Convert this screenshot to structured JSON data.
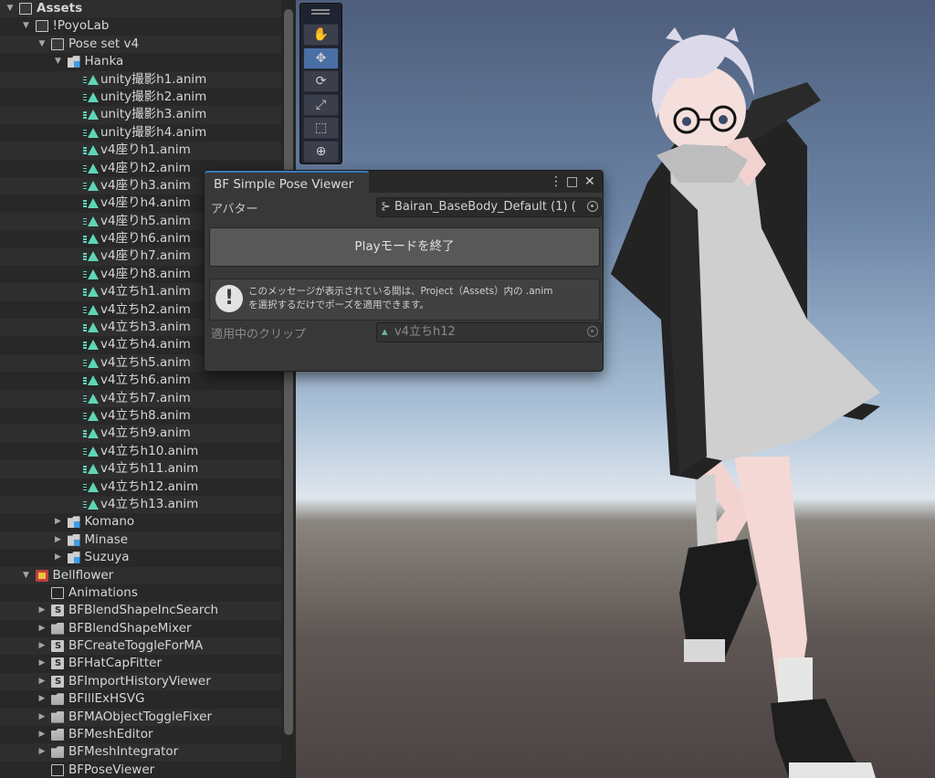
{
  "project_tree": {
    "rows": [
      {
        "label": "Assets",
        "depth": 0,
        "arrow": "▼",
        "icon": "folder-open-icon"
      },
      {
        "label": "!PoyoLab",
        "depth": 1,
        "arrow": "▼",
        "icon": "folder-open-icon"
      },
      {
        "label": "Pose set v4",
        "depth": 2,
        "arrow": "▼",
        "icon": "folder-open-icon"
      },
      {
        "label": "Hanka",
        "depth": 3,
        "arrow": "▼",
        "icon": "prefab-folder-icon"
      },
      {
        "label": "unity撮影h1.anim",
        "depth": 4,
        "arrow": "",
        "icon": "animation-clip-icon"
      },
      {
        "label": "unity撮影h2.anim",
        "depth": 4,
        "arrow": "",
        "icon": "animation-clip-icon"
      },
      {
        "label": "unity撮影h3.anim",
        "depth": 4,
        "arrow": "",
        "icon": "animation-clip-icon"
      },
      {
        "label": "unity撮影h4.anim",
        "depth": 4,
        "arrow": "",
        "icon": "animation-clip-icon"
      },
      {
        "label": "v4座りh1.anim",
        "depth": 4,
        "arrow": "",
        "icon": "animation-clip-icon"
      },
      {
        "label": "v4座りh2.anim",
        "depth": 4,
        "arrow": "",
        "icon": "animation-clip-icon"
      },
      {
        "label": "v4座りh3.anim",
        "depth": 4,
        "arrow": "",
        "icon": "animation-clip-icon"
      },
      {
        "label": "v4座りh4.anim",
        "depth": 4,
        "arrow": "",
        "icon": "animation-clip-icon"
      },
      {
        "label": "v4座りh5.anim",
        "depth": 4,
        "arrow": "",
        "icon": "animation-clip-icon"
      },
      {
        "label": "v4座りh6.anim",
        "depth": 4,
        "arrow": "",
        "icon": "animation-clip-icon"
      },
      {
        "label": "v4座りh7.anim",
        "depth": 4,
        "arrow": "",
        "icon": "animation-clip-icon"
      },
      {
        "label": "v4座りh8.anim",
        "depth": 4,
        "arrow": "",
        "icon": "animation-clip-icon"
      },
      {
        "label": "v4立ちh1.anim",
        "depth": 4,
        "arrow": "",
        "icon": "animation-clip-icon"
      },
      {
        "label": "v4立ちh2.anim",
        "depth": 4,
        "arrow": "",
        "icon": "animation-clip-icon"
      },
      {
        "label": "v4立ちh3.anim",
        "depth": 4,
        "arrow": "",
        "icon": "animation-clip-icon"
      },
      {
        "label": "v4立ちh4.anim",
        "depth": 4,
        "arrow": "",
        "icon": "animation-clip-icon"
      },
      {
        "label": "v4立ちh5.anim",
        "depth": 4,
        "arrow": "",
        "icon": "animation-clip-icon"
      },
      {
        "label": "v4立ちh6.anim",
        "depth": 4,
        "arrow": "",
        "icon": "animation-clip-icon"
      },
      {
        "label": "v4立ちh7.anim",
        "depth": 4,
        "arrow": "",
        "icon": "animation-clip-icon"
      },
      {
        "label": "v4立ちh8.anim",
        "depth": 4,
        "arrow": "",
        "icon": "animation-clip-icon"
      },
      {
        "label": "v4立ちh9.anim",
        "depth": 4,
        "arrow": "",
        "icon": "animation-clip-icon"
      },
      {
        "label": "v4立ちh10.anim",
        "depth": 4,
        "arrow": "",
        "icon": "animation-clip-icon"
      },
      {
        "label": "v4立ちh11.anim",
        "depth": 4,
        "arrow": "",
        "icon": "animation-clip-icon"
      },
      {
        "label": "v4立ちh12.anim",
        "depth": 4,
        "arrow": "",
        "icon": "animation-clip-icon"
      },
      {
        "label": "v4立ちh13.anim",
        "depth": 4,
        "arrow": "",
        "icon": "animation-clip-icon"
      },
      {
        "label": "Komano",
        "depth": 3,
        "arrow": "▶",
        "icon": "prefab-folder-icon"
      },
      {
        "label": "Minase",
        "depth": 3,
        "arrow": "▶",
        "icon": "prefab-folder-icon"
      },
      {
        "label": "Suzuya",
        "depth": 3,
        "arrow": "▶",
        "icon": "prefab-folder-icon"
      },
      {
        "label": "Bellflower",
        "depth": 1,
        "arrow": "▼",
        "icon": "bellflower-folder-icon"
      },
      {
        "label": "Animations",
        "depth": 2,
        "arrow": "",
        "icon": "folder-empty-icon"
      },
      {
        "label": "BFBlendShapeIncSearch",
        "depth": 2,
        "arrow": "▶",
        "icon": "script-folder-icon"
      },
      {
        "label": "BFBlendShapeMixer",
        "depth": 2,
        "arrow": "▶",
        "icon": "folder-icon"
      },
      {
        "label": "BFCreateToggleForMA",
        "depth": 2,
        "arrow": "▶",
        "icon": "script-folder-icon"
      },
      {
        "label": "BFHatCapFitter",
        "depth": 2,
        "arrow": "▶",
        "icon": "script-folder-icon"
      },
      {
        "label": "BFImportHistoryViewer",
        "depth": 2,
        "arrow": "▶",
        "icon": "script-folder-icon"
      },
      {
        "label": "BFIllExHSVG",
        "depth": 2,
        "arrow": "▶",
        "icon": "folder-icon"
      },
      {
        "label": "BFMAObjectToggleFixer",
        "depth": 2,
        "arrow": "▶",
        "icon": "folder-icon"
      },
      {
        "label": "BFMeshEditor",
        "depth": 2,
        "arrow": "▶",
        "icon": "folder-icon"
      },
      {
        "label": "BFMeshIntegrator",
        "depth": 2,
        "arrow": "▶",
        "icon": "folder-icon"
      },
      {
        "label": "BFPoseViewer",
        "depth": 2,
        "arrow": "",
        "icon": "folder-empty-icon"
      }
    ]
  },
  "scene_tools": [
    {
      "name": "hand-tool",
      "glyph": "✋",
      "active": false
    },
    {
      "name": "move-tool",
      "glyph": "✥",
      "active": true
    },
    {
      "name": "rotate-tool",
      "glyph": "⟳",
      "active": false
    },
    {
      "name": "scale-tool",
      "glyph": "⤢",
      "active": false
    },
    {
      "name": "rect-tool",
      "glyph": "⬚",
      "active": false
    },
    {
      "name": "transform-tool",
      "glyph": "⊕",
      "active": false
    }
  ],
  "pose_viewer": {
    "tab_title": "BF Simple Pose Viewer",
    "menu_glyph": "⋮",
    "maximize_glyph": "□",
    "close_glyph": "✕",
    "avatar_label": "アバター",
    "avatar_value": "Bairan_BaseBody_Default (1) (",
    "avatar_prefix_glyph": "⊱",
    "play_button": "Playモードを終了",
    "help_icon_glyph": "!",
    "help_line1": "このメッセージが表示されている間は、Project（Assets）内の .anim",
    "help_line2": "を選択するだけでポーズを適用できます。",
    "clip_label": "適用中のクリップ",
    "clip_value": "v4立ちh12",
    "clip_prefix_glyph": "▴"
  },
  "colors": {
    "accent_blue": "#3a79bb",
    "anim_icon": "#5ed6b6"
  }
}
